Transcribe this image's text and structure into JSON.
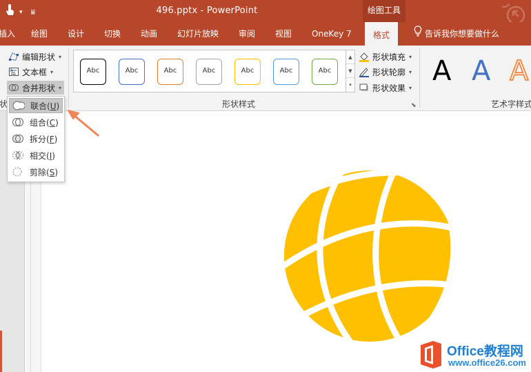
{
  "window": {
    "title": "496.pptx  -  PowerPoint",
    "context_tab_group": "绘图工具"
  },
  "tabs": [
    {
      "label": "插入",
      "partial": true
    },
    {
      "label": "绘图"
    },
    {
      "label": "设计"
    },
    {
      "label": "切换"
    },
    {
      "label": "动画"
    },
    {
      "label": "幻灯片放映"
    },
    {
      "label": "审阅"
    },
    {
      "label": "视图"
    },
    {
      "label": "OneKey 7"
    },
    {
      "label": "格式",
      "active": true
    }
  ],
  "tell_me": "告诉我你想要做什么",
  "ribbon": {
    "insert_shapes": {
      "edit_shape": "编辑形状",
      "text_box": "文本框",
      "merge_shapes": "合并形状",
      "group_label_partial": "状"
    },
    "shape_styles": {
      "group_label": "形状样式",
      "swatches": [
        {
          "label": "Abc",
          "color": "#000000"
        },
        {
          "label": "Abc",
          "color": "#4472c4"
        },
        {
          "label": "Abc",
          "color": "#ed7d31"
        },
        {
          "label": "Abc",
          "color": "#a5a5a5"
        },
        {
          "label": "Abc",
          "color": "#ffc000"
        },
        {
          "label": "Abc",
          "color": "#5b9bd5"
        },
        {
          "label": "Abc",
          "color": "#70ad47"
        }
      ],
      "fill": "形状填充",
      "outline": "形状轮廓",
      "effects": "形状效果"
    },
    "wordart": {
      "group_label": "艺术字样式",
      "samples": [
        {
          "label": "A",
          "color": "#000000"
        },
        {
          "label": "A",
          "color": "#4472c4"
        },
        {
          "label": "A",
          "color": "#f4b183"
        }
      ]
    }
  },
  "merge_menu": {
    "items": [
      {
        "label": "联合",
        "key": "U",
        "hover": true
      },
      {
        "label": "组合",
        "key": "C"
      },
      {
        "label": "拆分",
        "key": "F"
      },
      {
        "label": "相交",
        "key": "I"
      },
      {
        "label": "剪除",
        "key": "S"
      }
    ]
  },
  "canvas": {
    "shape_color": "#ffc000"
  },
  "colors": {
    "title_bar": "#b7472a",
    "arrow": "#f0855a"
  },
  "watermark": {
    "name": "Office教程网",
    "url": "www.office26.com"
  }
}
